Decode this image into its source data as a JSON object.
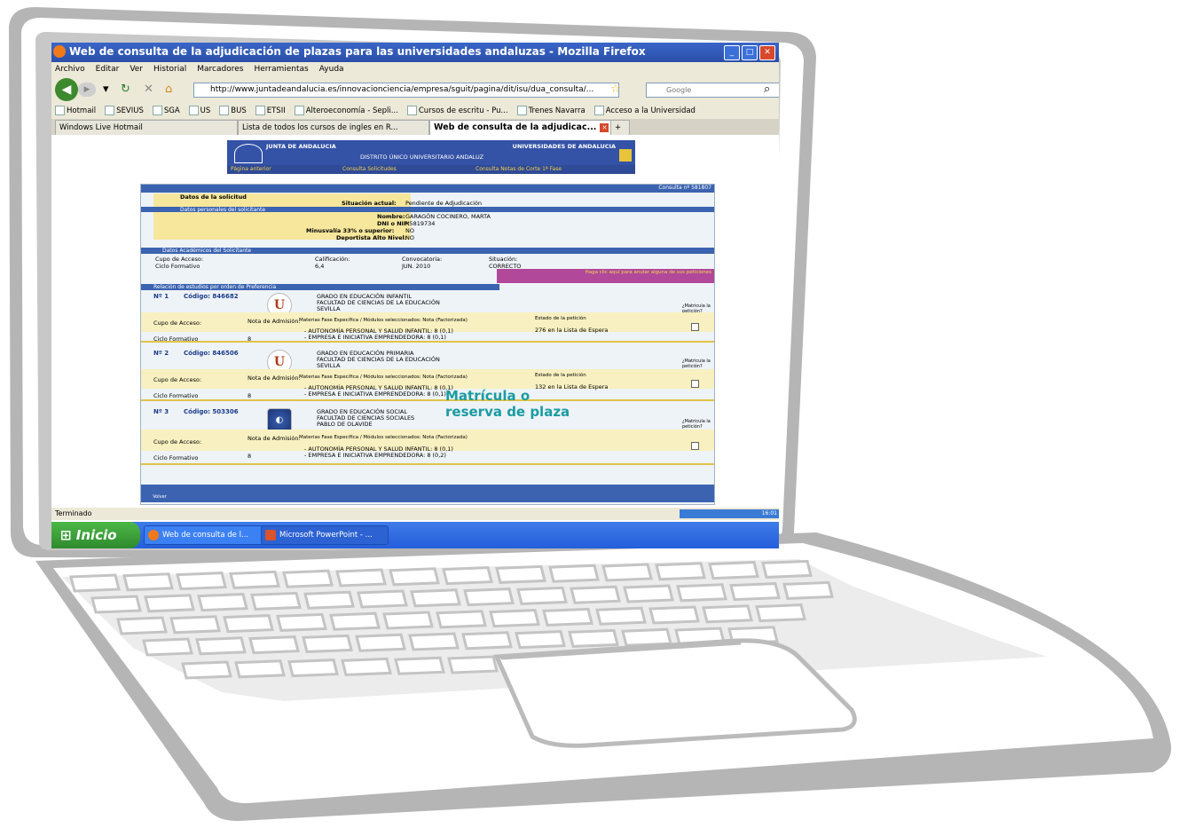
{
  "colors": {
    "titlebar": "#2a4fa8",
    "junta_blue": "#3452a6",
    "form_yellow": "#f6e79c",
    "matricula_teal": "#1a9ba2",
    "pink_box": "#b1489a",
    "xp_green": "#2f8a2d"
  },
  "window": {
    "title": "Web de consulta de la adjudicación de plazas para las universidades andaluzas - Mozilla Firefox"
  },
  "menu": [
    "Archivo",
    "Editar",
    "Ver",
    "Historial",
    "Marcadores",
    "Herramientas",
    "Ayuda"
  ],
  "nav": {
    "url": "http://www.juntadeandalucia.es/innovacionciencia/empresa/sguit/pagina/dit/isu/dua_consulta/...",
    "search_placeholder": "Google"
  },
  "bookmarks": [
    "Hotmail",
    "SEVIUS",
    "SGA",
    "US",
    "BUS",
    "ETSII",
    "Alteroeconomía - Sepli...",
    "Cursos de escritu - Pu...",
    "Trenes Navarra",
    "Acceso a la Universidad"
  ],
  "tabs": {
    "tab1": "Windows Live Hotmail",
    "tab2": "Lista de todos los cursos de ingles en R...",
    "tab3": "Web de consulta de la adjudicac..."
  },
  "header": {
    "junta": "JUNTA DE ANDALUCIA",
    "universidades": "UNIVERSIDADES DE ANDALUCIA",
    "distrito": "DISTRITO ÚNICO UNIVERSITARIO ANDALUZ",
    "link1": "Página anterior",
    "link2": "Consulta Solicitudes",
    "link3": "Consulta Notas de Corte 1ª Fase"
  },
  "form": {
    "consulta": "Consulta nº 581807",
    "datos_solicitud": "Datos de la solicitud",
    "situacion_label": "Situación actual:",
    "situacion_value": "Pendiente de Adjudicación",
    "datos_personales": "Datos personales del solicitante",
    "nombre_label": "Nombre:",
    "nombre_value": "GARAGÓN COCINERO, MARTA",
    "dni_label": "DNI o NIF:",
    "dni_value": "X5819734",
    "minusvalia_label": "Minusvalía 33% o superior:",
    "minusvalia_value": "NO",
    "deportista_label": "Deportista Alto Nivel:",
    "deportista_value": "NO",
    "academicos": "Datos Académicos del Solicitante",
    "cupo_label": "Cupo de Acceso:",
    "cupo_value": "Ciclo Formativo",
    "calificacion_label": "Calificación:",
    "calificacion_value": "6,4",
    "convocatoria_label": "Convocatoria:",
    "convocatoria_value": "JUN. 2010",
    "situacion2_label": "Situación:",
    "situacion2_value": "CORRECTO",
    "pink_text": "Haga clic aquí para anular alguna de sus peticiones",
    "relacion": "Relación de estudios por orden de Preferencia"
  },
  "peticiones": [
    {
      "num": "Nº 1",
      "codigo": "Código: 846682",
      "grado": "GRADO EN EDUCACIÓN INFANTIL",
      "facultad": "FACULTAD DE CIENCIAS DE LA EDUCACIÓN",
      "ciudad": "SEVILLA",
      "nota_label": "Nota de Admisión:",
      "nota_value": "8",
      "materias_label": "Materias Fase Específica / Módulos seleccionados: Nota (Factorizada)",
      "materia1": "- AUTONOMÍA PERSONAL Y SALUD INFANTIL: 8 (0,1)",
      "materia2": "- EMPRESA E INICIATIVA EMPRENDEDORA: 8 (0,1)",
      "estado_label": "Estado de la petición",
      "estado_value": "276 en la Lista de Espera",
      "cupo_label": "Cupo de Acceso:",
      "cupo_value": "Ciclo Formativo",
      "matricula": "¿Matricula la petición?"
    },
    {
      "num": "Nº 2",
      "codigo": "Código: 846506",
      "grado": "GRADO EN EDUCACIÓN PRIMARIA",
      "facultad": "FACULTAD DE CIENCIAS DE LA EDUCACIÓN",
      "ciudad": "SEVILLA",
      "nota_label": "Nota de Admisión:",
      "nota_value": "8",
      "materias_label": "Materias Fase Específica / Módulos seleccionados: Nota (Factorizada)",
      "materia1": "- AUTONOMÍA PERSONAL Y SALUD INFANTIL: 8 (0,1)",
      "materia2": "- EMPRESA E INICIATIVA EMPRENDEDORA: 8 (0,1)",
      "estado_label": "Estado de la petición",
      "estado_value": "132 en la Lista de Espera",
      "cupo_label": "Cupo de Acceso:",
      "cupo_value": "Ciclo Formativo",
      "matricula": "¿Matricula la petición?"
    },
    {
      "num": "Nº 3",
      "codigo": "Código: 503306",
      "grado": "GRADO EN EDUCACIÓN SOCIAL",
      "facultad": "FACULTAD DE CIENCIAS SOCIALES",
      "ciudad": "PABLO DE OLAVIDE",
      "nota_label": "Nota de Admisión:",
      "nota_value": "8",
      "materias_label": "Materias Fase Específica / Módulos seleccionados: Nota (Factorizada)",
      "materia1": "- AUTONOMÍA PERSONAL Y SALUD INFANTIL: 8 (0,1)",
      "materia2": "- EMPRESA E INICIATIVA EMPRENDEDORA: 8 (0,2)",
      "cupo_label": "Cupo de Acceso:",
      "cupo_value": "Ciclo Formativo",
      "matricula": "¿Matricula la petición?"
    }
  ],
  "overlay": {
    "matricula_line1": "Matrícula o",
    "matricula_line2": "reserva de plaza"
  },
  "volver": "Volver",
  "status": "Terminado",
  "tray_time": "16:01",
  "taskbar": {
    "start": "Inicio",
    "task1": "Web de consulta de l...",
    "task2": "Microsoft PowerPoint - ..."
  }
}
